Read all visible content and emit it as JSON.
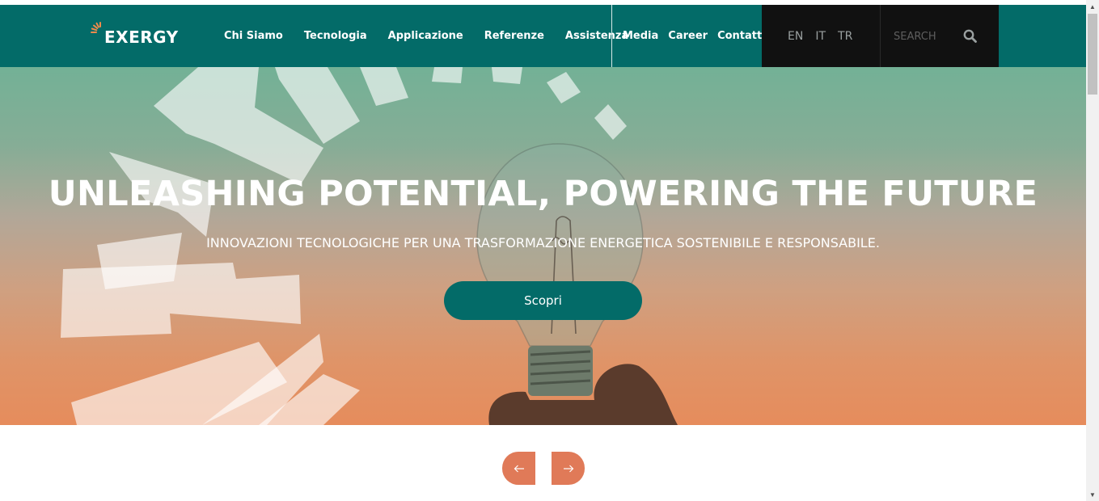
{
  "brand": {
    "name": "EXERGY",
    "accent": "#036b68",
    "orange": "#e07a58"
  },
  "nav": {
    "main": [
      "Chi Siamo",
      "Tecnologia",
      "Applicazione",
      "Referenze",
      "Assistenza"
    ],
    "secondary": [
      "Media",
      "Career",
      "Contatti"
    ]
  },
  "languages": [
    "EN",
    "IT",
    "TR"
  ],
  "search": {
    "placeholder": "SEARCH",
    "icon": "search-icon"
  },
  "hero": {
    "title": "UNLEASHING POTENTIAL, POWERING THE FUTURE",
    "subtitle": "INNOVAZIONI TECNOLOGICHE PER UNA TRASFORMAZIONE ENERGETICA SOSTENIBILE E RESPONSABILE.",
    "cta": "Scopri"
  },
  "carousel": {
    "prev_icon": "arrow-left-icon",
    "next_icon": "arrow-right-icon"
  }
}
